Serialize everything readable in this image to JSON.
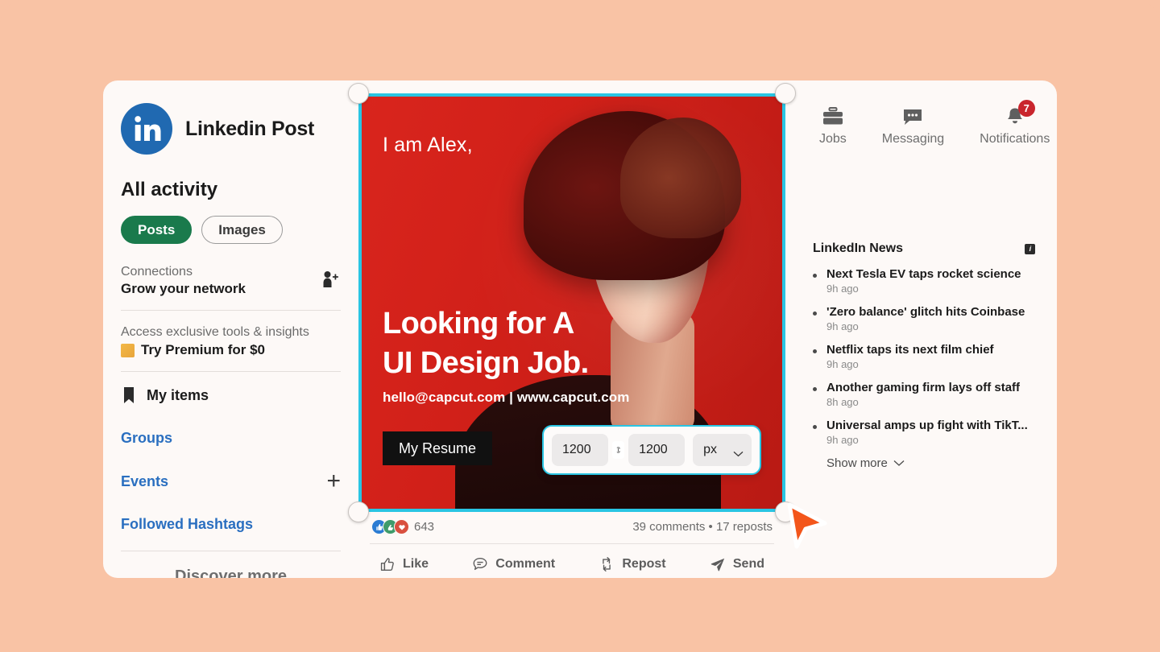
{
  "theme": {
    "background": "#f9c3a5",
    "card_background": "#fdf9f7",
    "accent_selection": "#29c5e3",
    "linkedin_blue": "#2069b1",
    "pill_green": "#1a7a4c",
    "cursor_orange": "#f3561b",
    "poster_red": "#d9251d"
  },
  "sidebar": {
    "logo_icon": "linkedin-icon",
    "brand_title": "Linkedin Post",
    "section_title": "All activity",
    "pills": [
      {
        "label": "Posts",
        "active": true
      },
      {
        "label": "Images",
        "active": false
      }
    ],
    "connections": {
      "label": "Connections",
      "subtitle": "Grow your network",
      "icon": "add-person-icon"
    },
    "premium": {
      "label": "Access exclusive tools & insights",
      "cta": "Try Premium for $0",
      "icon": "premium-badge-icon"
    },
    "my_items": {
      "label": "My items",
      "icon": "bookmark-icon"
    },
    "nav_links": [
      {
        "label": "Groups",
        "has_plus": false
      },
      {
        "label": "Events",
        "has_plus": true
      },
      {
        "label": "Followed Hashtags",
        "has_plus": false
      }
    ],
    "discover_more": "Discover more"
  },
  "post": {
    "creative": {
      "intro": "I am Alex,",
      "headline_line1": "Looking for A",
      "headline_line2": "UI Design Job.",
      "contact": "hello@capcut.com | www.capcut.com",
      "resume_button": "My Resume"
    },
    "size_popup": {
      "width_value": "1200",
      "height_value": "1200",
      "unit_value": "px",
      "link_icon": "link-proportions-icon",
      "chevron_icon": "chevron-down-icon"
    },
    "engagement": {
      "reaction_count": "643",
      "reactions": [
        "like-reaction-icon",
        "celebrate-reaction-icon",
        "love-reaction-icon"
      ],
      "comments_reposts": "39 comments • 17 reposts",
      "actions": [
        {
          "label": "Like",
          "icon": "thumbs-up-icon"
        },
        {
          "label": "Comment",
          "icon": "comment-bubble-icon"
        },
        {
          "label": "Repost",
          "icon": "repost-icon"
        },
        {
          "label": "Send",
          "icon": "send-paper-plane-icon"
        }
      ]
    }
  },
  "topnav": [
    {
      "label": "Jobs",
      "icon": "briefcase-icon",
      "badge": ""
    },
    {
      "label": "Messaging",
      "icon": "message-bubble-icon",
      "badge": ""
    },
    {
      "label": "Notifications",
      "icon": "bell-icon",
      "badge": "7"
    }
  ],
  "news": {
    "title": "LinkedIn News",
    "info_icon": "info-icon",
    "items": [
      {
        "title": "Next Tesla EV taps rocket science",
        "time": "9h ago"
      },
      {
        "title": "'Zero balance' glitch hits Coinbase",
        "time": "9h ago"
      },
      {
        "title": "Netflix taps its next film chief",
        "time": "9h ago"
      },
      {
        "title": "Another gaming firm lays off staff",
        "time": "8h ago"
      },
      {
        "title": "Universal amps up fight with TikT...",
        "time": "9h ago"
      }
    ],
    "show_more": "Show more"
  },
  "cursor": {
    "icon": "pointer-cursor-icon"
  }
}
